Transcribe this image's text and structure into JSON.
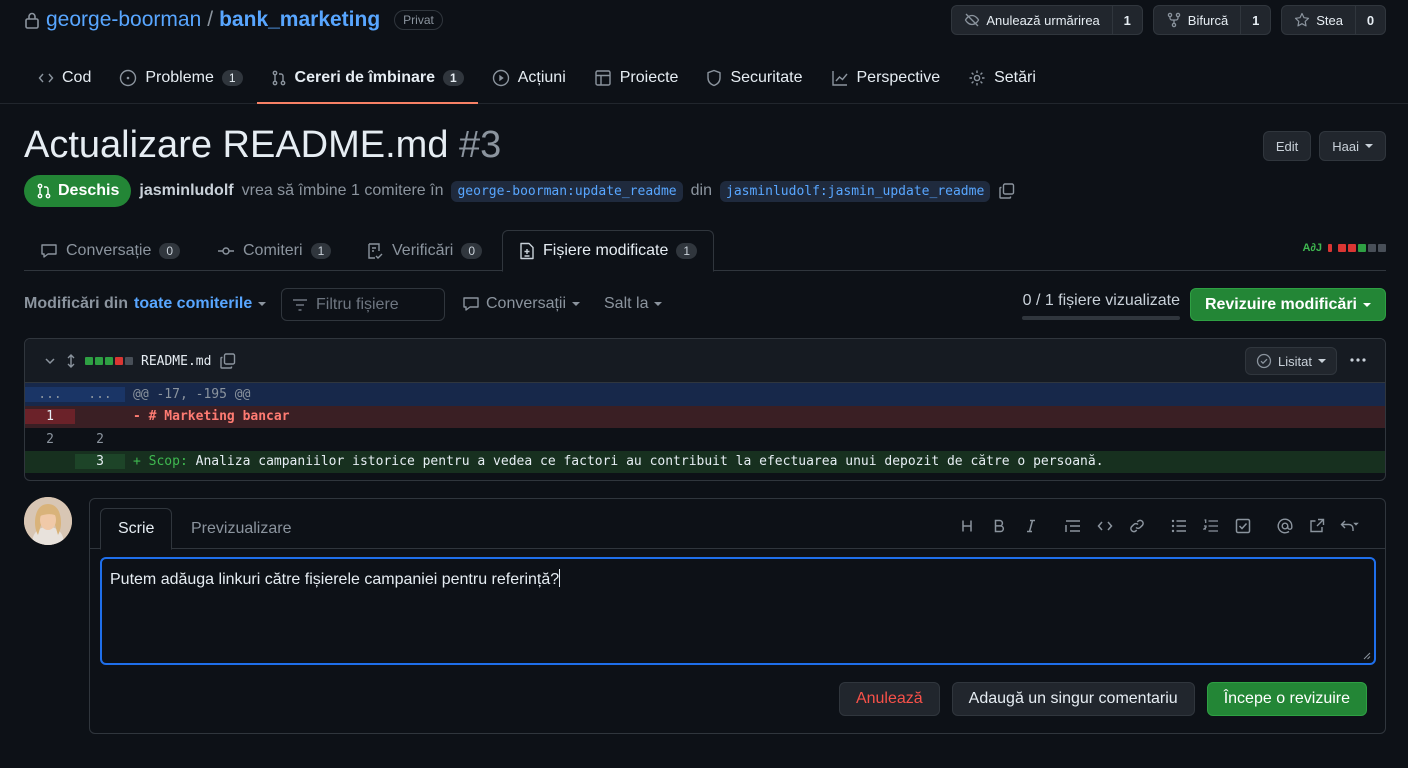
{
  "repo": {
    "owner": "george-boorman",
    "separator": "/",
    "name": "bank_marketing",
    "visibility": "Privat",
    "unwatch_label": "Anulează urmărirea",
    "unwatch_count": "1",
    "fork_label": "Bifurcă",
    "fork_count": "1",
    "star_label": "Stea",
    "star_count": "0"
  },
  "nav": [
    {
      "label": "Cod",
      "icon": "code-icon"
    },
    {
      "label": "Probleme",
      "count": "1",
      "icon": "issue-icon"
    },
    {
      "label": "Cereri de îmbinare",
      "count": "1",
      "icon": "pull-request-icon",
      "active": true
    },
    {
      "label": "Acțiuni",
      "icon": "play-icon"
    },
    {
      "label": "Proiecte",
      "icon": "table-icon"
    },
    {
      "label": "Securitate",
      "icon": "shield-icon"
    },
    {
      "label": "Perspective",
      "icon": "graph-icon"
    },
    {
      "label": "Setări",
      "icon": "gear-icon"
    }
  ],
  "pr": {
    "title": "Actualizare README.md",
    "number": "#3",
    "edit_label": "Edit",
    "code_label": "Haai",
    "state": "Deschis",
    "author": "jasminludolf",
    "meta_text": "vrea să îmbine 1 comitere în",
    "base_branch": "george-boorman:update_readme",
    "from_text": "din",
    "head_branch": "jasminludolf:jasmin_update_readme"
  },
  "tabs": [
    {
      "label": "Conversație",
      "count": "0",
      "icon": "comment-icon"
    },
    {
      "label": "Comiteri",
      "count": "1",
      "icon": "commit-icon"
    },
    {
      "label": "Verificări",
      "count": "0",
      "icon": "checklist-icon"
    },
    {
      "label": "Fișiere modificate",
      "count": "1",
      "icon": "file-diff-icon",
      "active": true
    }
  ],
  "diffstat_summary": "A∂J",
  "toolbar": {
    "changes_prefix": "Modificări din",
    "changes_link": "toate comiterile",
    "filter_placeholder": "Filtru fișiere",
    "conversations_label": "Conversații",
    "jump_label": "Salt la",
    "viewed_text": "0 / 1 fișiere vizualizate",
    "viewed_progress": 0,
    "review_button": "Revizuire modificări"
  },
  "file": {
    "name": "README.md",
    "viewed_label": "Lisitat",
    "lines": [
      {
        "type": "hunk",
        "old": "...",
        "new": "...",
        "text": "@@ -17, -195 @@"
      },
      {
        "type": "del",
        "old": "1",
        "new": "",
        "text": "- # Marketing bancar"
      },
      {
        "type": "ctx",
        "old": "2",
        "new": "2",
        "text": ""
      },
      {
        "type": "add",
        "old": "",
        "new": "3",
        "prefix": "+ Scop:",
        "text": " Analiza campaniilor istorice pentru a vedea ce factori au contribuit la efectuarea unui depozit de către o persoană."
      }
    ]
  },
  "comment": {
    "tab_write": "Scrie",
    "tab_preview": "Previzualizare",
    "text": "Putem adăuga linkuri către fișierele campaniei pentru referință?",
    "cancel_label": "Anulează",
    "single_label": "Adaugă un singur comentariu",
    "start_review_label": "Începe o revizuire"
  },
  "colors": {
    "accent_blue": "#58a6ff",
    "open_green": "#238636",
    "active_tab_underline": "#f78166",
    "deletion_red": "#f85149"
  }
}
